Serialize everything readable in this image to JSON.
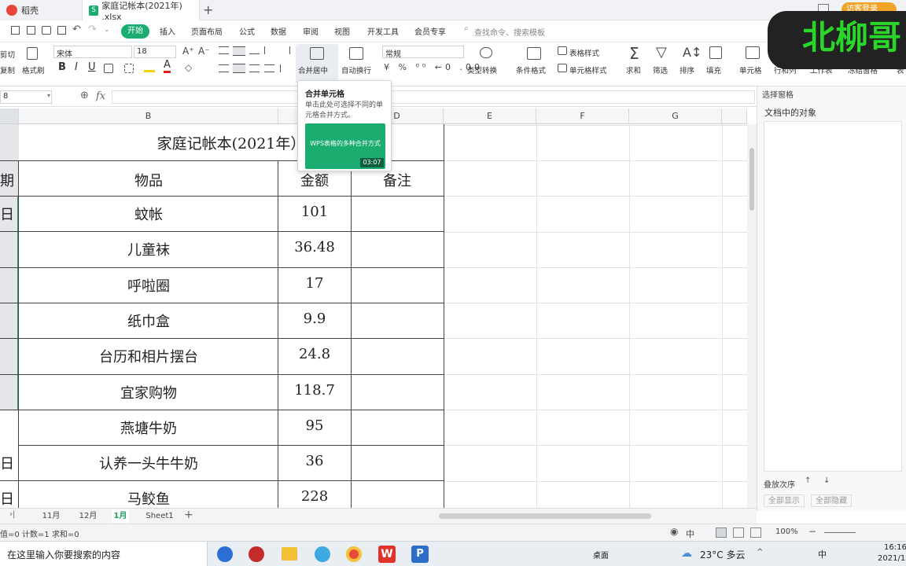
{
  "tabs": {
    "home_tab": "稻壳",
    "file_tab": "家庭记帐本(2021年) .xlsx",
    "add": "+",
    "login": "访客登录"
  },
  "menu": {
    "start": "开始",
    "items": [
      "插入",
      "页面布局",
      "公式",
      "数据",
      "审阅",
      "视图",
      "开发工具",
      "会员专享"
    ],
    "search_placeholder": "查找命令、搜索模板"
  },
  "ribbon": {
    "cut": "剪切",
    "copy": "复制",
    "format_painter": "格式刷",
    "font_name": "宋体",
    "font_size": "18",
    "number_format": "常规",
    "merge_center": "合并居中",
    "wrap": "自动换行",
    "type_convert": "类型转换",
    "cond_format": "条件格式",
    "table_style": "表格样式",
    "cell_style": "单元格样式",
    "sum": "求和",
    "filter": "筛选",
    "sort": "排序",
    "fill": "填充",
    "cell": "单元格",
    "rowcol": "行和列",
    "sheet": "工作表",
    "freeze": "冻结窗格",
    "table_tools": "表"
  },
  "tooltip": {
    "title": "合并单元格",
    "desc": "单击此处可选择不同的单元格合并方式。",
    "video_title": "WPS表格的多种合并方式",
    "duration": "03:07"
  },
  "formula": {
    "namebox": "8",
    "fx": "fx"
  },
  "grid": {
    "columns": [
      "B",
      "D",
      "E",
      "F",
      "G"
    ],
    "title": "家庭记帐本(2021年）",
    "header_partial": "期",
    "header_item": "物品",
    "header_amount": "金额",
    "header_note": "备注",
    "rows": [
      {
        "date": "日",
        "item": "蚊帐",
        "amount": "101"
      },
      {
        "date": "",
        "item": "儿童袜",
        "amount": "36.48"
      },
      {
        "date": "",
        "item": "呼啦圈",
        "amount": "17"
      },
      {
        "date": "",
        "item": "纸巾盒",
        "amount": "9.9"
      },
      {
        "date": "",
        "item": "台历和相片摆台",
        "amount": "24.8"
      },
      {
        "date": "",
        "item": "宜家购物",
        "amount": "118.7"
      },
      {
        "date": "",
        "item": "燕塘牛奶",
        "amount": "95"
      },
      {
        "date": "日",
        "item": "认养一头牛牛奶",
        "amount": "36"
      },
      {
        "date": "日",
        "item": "马鲛鱼",
        "amount": "228"
      }
    ]
  },
  "right_panel": {
    "title": "选择窗格",
    "objects": "文档中的对象",
    "stack_order": "叠放次序",
    "show_all": "全部显示",
    "hide_all": "全部隐藏"
  },
  "sheets": [
    "11月",
    "12月",
    "1月",
    "Sheet1"
  ],
  "active_sheet": "1月",
  "status": {
    "left": "值=0  计数=1  求和=0",
    "zoom": "100%",
    "mode": "中"
  },
  "taskbar": {
    "search": "在这里输入你要搜索的内容",
    "desktop": "桌面",
    "weather": "23°C  多云",
    "ime": "中",
    "time": "16:16",
    "date": "2021/12"
  },
  "watermark": "北柳哥",
  "colors": {
    "accent": "#1aad6f",
    "watermark": "#2bd62b",
    "selection": "#1e9e62"
  }
}
